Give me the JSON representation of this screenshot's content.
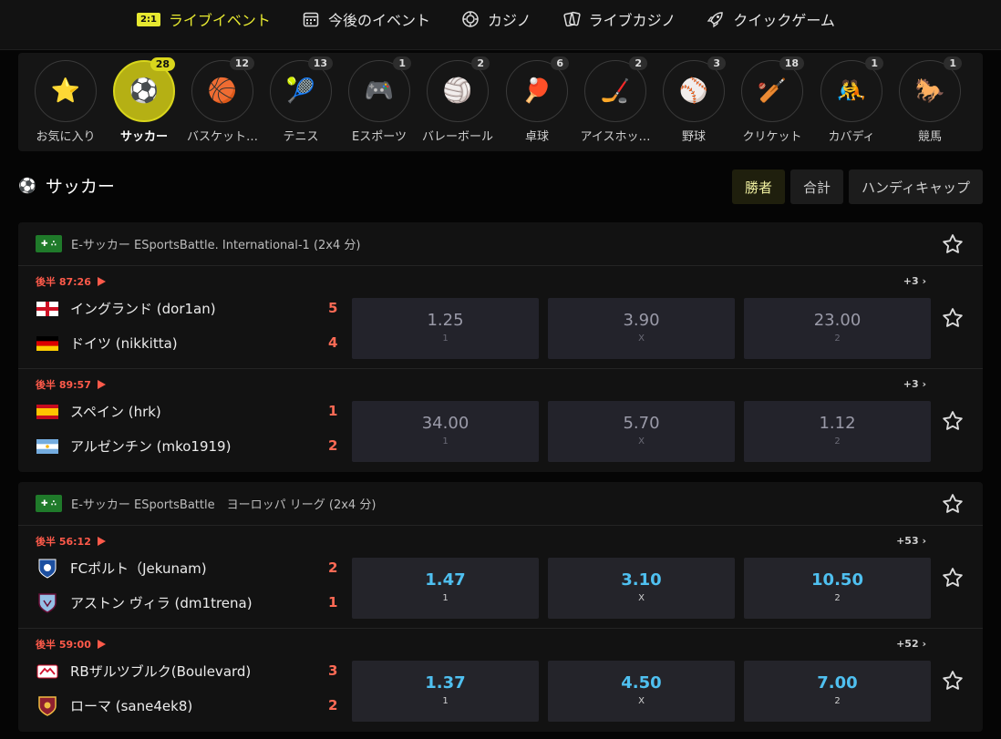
{
  "nav": [
    {
      "label": "ライブイベント",
      "badge": "2:1",
      "icon": "live-badge",
      "active": true
    },
    {
      "label": "今後のイベント",
      "icon": "calendar-icon"
    },
    {
      "label": "カジノ",
      "icon": "chip-icon"
    },
    {
      "label": "ライブカジノ",
      "icon": "cards-icon"
    },
    {
      "label": "クイックゲーム",
      "icon": "rocket-icon"
    }
  ],
  "sports": [
    {
      "label": "お気に入り",
      "icon": "star-icon",
      "glyph": "⭐",
      "count": ""
    },
    {
      "label": "サッカー",
      "icon": "soccer-icon",
      "glyph": "⚽",
      "count": "28",
      "active": true
    },
    {
      "label": "バスケット…",
      "icon": "basketball-icon",
      "glyph": "🏀",
      "count": "12"
    },
    {
      "label": "テニス",
      "icon": "tennis-icon",
      "glyph": "🎾",
      "count": "13"
    },
    {
      "label": "Eスポーツ",
      "icon": "gamepad-icon",
      "glyph": "🎮",
      "count": "1"
    },
    {
      "label": "バレーボール",
      "icon": "volleyball-icon",
      "glyph": "🏐",
      "count": "2"
    },
    {
      "label": "卓球",
      "icon": "table-tennis-icon",
      "glyph": "🏓",
      "count": "6"
    },
    {
      "label": "アイスホッ…",
      "icon": "hockey-puck-icon",
      "glyph": "🏒",
      "count": "2"
    },
    {
      "label": "野球",
      "icon": "baseball-icon",
      "glyph": "⚾",
      "count": "3"
    },
    {
      "label": "クリケット",
      "icon": "cricket-icon",
      "glyph": "🏏",
      "count": "18"
    },
    {
      "label": "カバディ",
      "icon": "kabaddi-icon",
      "glyph": "🤼",
      "count": "1"
    },
    {
      "label": "競馬",
      "icon": "horse-icon",
      "glyph": "🐎",
      "count": "1"
    }
  ],
  "section": {
    "title": "サッカー"
  },
  "market_tabs": [
    {
      "label": "勝者",
      "active": true
    },
    {
      "label": "合計"
    },
    {
      "label": "ハンディキャップ"
    }
  ],
  "leagues": [
    {
      "name": "E-サッカー ESportsBattle. International-1 (2x4 分)",
      "matches": [
        {
          "time": "後半 87:26",
          "more": "+3",
          "home": "イングランド (dor1an)",
          "home_flag": "england-flag",
          "away": "ドイツ (nikkitta)",
          "away_flag": "germany-flag",
          "home_score": "5",
          "away_score": "4",
          "odds": [
            {
              "val": "1.25",
              "lab": "1"
            },
            {
              "val": "3.90",
              "lab": "X"
            },
            {
              "val": "23.00",
              "lab": "2"
            }
          ],
          "live": false
        },
        {
          "time": "後半 89:57",
          "more": "+3",
          "home": "スペイン (hrk)",
          "home_flag": "spain-flag",
          "away": "アルゼンチン (mko1919)",
          "away_flag": "argentina-flag",
          "home_score": "1",
          "away_score": "2",
          "odds": [
            {
              "val": "34.00",
              "lab": "1"
            },
            {
              "val": "5.70",
              "lab": "X"
            },
            {
              "val": "1.12",
              "lab": "2"
            }
          ],
          "live": false
        }
      ]
    },
    {
      "name": "E-サッカー ESportsBattle　ヨーロッパ リーグ (2x4 分)",
      "matches": [
        {
          "time": "後半 56:12",
          "more": "+53",
          "home": "FCポルト（Jekunam)",
          "home_flag": "porto-crest",
          "away": "アストン ヴィラ (dm1trena)",
          "away_flag": "aston-villa-crest",
          "home_score": "2",
          "away_score": "1",
          "odds": [
            {
              "val": "1.47",
              "lab": "1"
            },
            {
              "val": "3.10",
              "lab": "X"
            },
            {
              "val": "10.50",
              "lab": "2"
            }
          ],
          "live": true
        },
        {
          "time": "後半 59:00",
          "more": "+52",
          "home": "RBザルツブルク(Boulevard)",
          "home_flag": "salzburg-crest",
          "away": "ローマ (sane4ek8)",
          "away_flag": "roma-crest",
          "home_score": "3",
          "away_score": "2",
          "odds": [
            {
              "val": "1.37",
              "lab": "1"
            },
            {
              "val": "4.50",
              "lab": "X"
            },
            {
              "val": "7.00",
              "lab": "2"
            }
          ],
          "live": true
        }
      ]
    }
  ],
  "colors": {
    "accent": "#e6e830",
    "live_time": "#ff5a4a",
    "score": "#ff6a55",
    "odds_live": "#4fc0f0"
  }
}
